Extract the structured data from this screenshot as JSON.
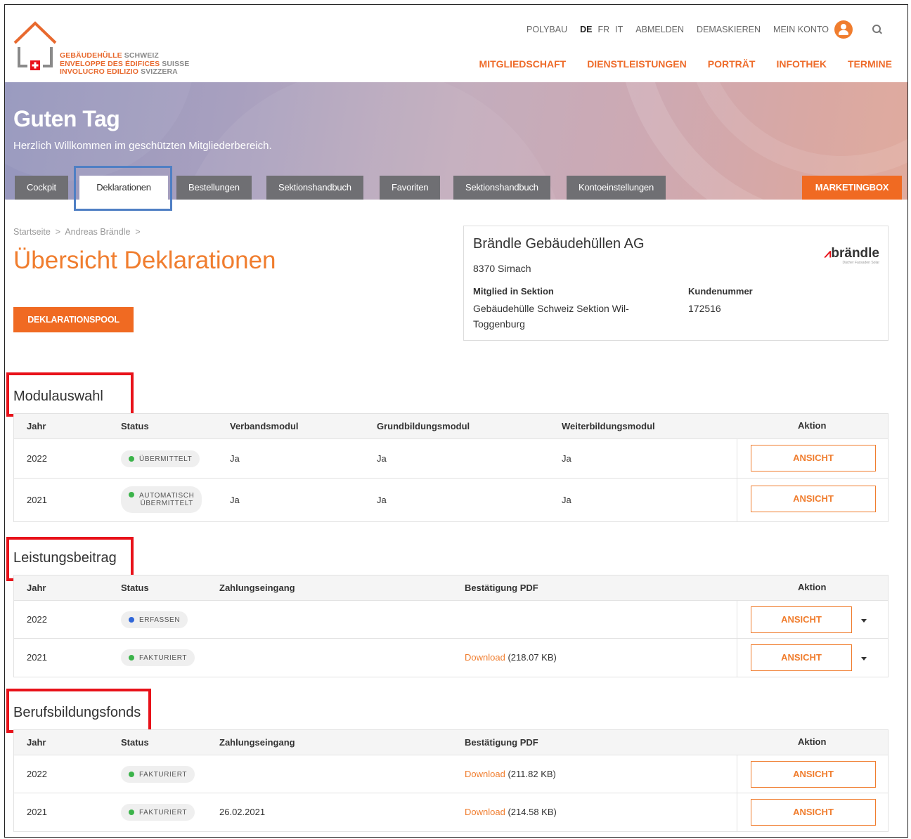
{
  "logo": {
    "line1_a": "GEBÄUDEHÜLLE",
    "line1_b": "SCHWEIZ",
    "line2_a": "ENVELOPPE DES ÉDIFICES",
    "line2_b": "SUISSE",
    "line3_a": "INVOLUCRO EDILIZIO",
    "line3_b": "SVIZZERA"
  },
  "utility": {
    "polybau": "POLYBAU",
    "lang_de": "DE",
    "lang_fr": "FR",
    "lang_it": "IT",
    "logout": "ABMELDEN",
    "unmask": "DEMASKIEREN",
    "account": "MEIN KONTO"
  },
  "nav": {
    "items": [
      "MITGLIEDSCHAFT",
      "DIENSTLEISTUNGEN",
      "PORTRÄT",
      "INFOTHEK",
      "TERMINE"
    ]
  },
  "hero": {
    "title": "Guten Tag",
    "subtitle": "Herzlich Willkommen im geschützten Mitgliederbereich.",
    "tabs": [
      "Cockpit",
      "Deklarationen",
      "Bestellungen",
      "Sektionshandbuch",
      "Favoriten",
      "Sektionshandbuch",
      "Kontoeinstellungen"
    ],
    "marketing": "MARKETINGBOX"
  },
  "breadcrumb": {
    "home": "Startseite",
    "user": "Andreas Brändle"
  },
  "page_title": "Übersicht Deklarationen",
  "pool_button": "DEKLARATIONSPOOL",
  "company": {
    "name": "Brändle Gebäudehüllen AG",
    "city": "8370 Sirnach",
    "section_label": "Mitglied in Sektion",
    "section_value_1": "Gebäudehülle Schweiz Sektion Wil-",
    "section_value_2": "Toggenburg",
    "customer_label": "Kundenummer",
    "customer_value": "172516",
    "brand": "brändle"
  },
  "modul": {
    "title": "Modulauswahl",
    "headers": [
      "Jahr",
      "Status",
      "Verbandsmodul",
      "Grundbildungsmodul",
      "Weiterbildungsmodul",
      "Aktion"
    ],
    "rows": [
      {
        "year": "2022",
        "status": "ÜBERMITTELT",
        "v": "Ja",
        "g": "Ja",
        "w": "Ja",
        "action": "ANSICHT"
      },
      {
        "year": "2021",
        "status_1": "AUTOMATISCH",
        "status_2": "ÜBERMITTELT",
        "v": "Ja",
        "g": "Ja",
        "w": "Ja",
        "action": "ANSICHT"
      }
    ]
  },
  "leistung": {
    "title": "Leistungsbeitrag",
    "headers": [
      "Jahr",
      "Status",
      "Zahlungseingang",
      "Bestätigung PDF",
      "Aktion"
    ],
    "rows": [
      {
        "year": "2022",
        "status": "ERFASSEN",
        "payment": "",
        "download": "",
        "size": "",
        "action": "ANSICHT"
      },
      {
        "year": "2021",
        "status": "FAKTURIERT",
        "payment": "",
        "download": "Download",
        "size": "(218.07 KB)",
        "action": "ANSICHT"
      }
    ]
  },
  "fonds": {
    "title": "Berufsbildungsfonds",
    "headers": [
      "Jahr",
      "Status",
      "Zahlungseingang",
      "Bestätigung PDF",
      "Aktion"
    ],
    "rows": [
      {
        "year": "2022",
        "status": "FAKTURIERT",
        "payment": "",
        "download": "Download",
        "size": "(211.82 KB)",
        "action": "ANSICHT"
      },
      {
        "year": "2021",
        "status": "FAKTURIERT",
        "payment": "26.02.2021",
        "download": "Download",
        "size": "(214.58 KB)",
        "action": "ANSICHT"
      }
    ]
  },
  "colors": {
    "accent": "#f07d2e",
    "highlight_red": "#e8121a",
    "highlight_blue": "#4f7fc4",
    "status_green": "#3bb34a",
    "status_blue": "#2f66d8"
  }
}
